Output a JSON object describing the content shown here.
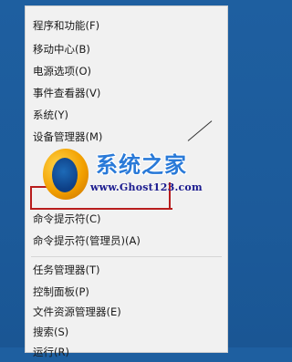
{
  "menu": {
    "items": [
      {
        "name": "programs-and-features",
        "label": "程序和功能(F)"
      },
      {
        "name": "mobility-center",
        "label": "移动中心(B)"
      },
      {
        "name": "power-options",
        "label": "电源选项(O)"
      },
      {
        "name": "event-viewer",
        "label": "事件查看器(V)"
      },
      {
        "name": "system",
        "label": "系统(Y)"
      },
      {
        "name": "device-manager",
        "label": "设备管理器(M)"
      },
      {
        "name": "command-prompt",
        "label": "命令提示符(C)"
      },
      {
        "name": "command-prompt-admin",
        "label": "命令提示符(管理员)(A)"
      },
      {
        "name": "task-manager",
        "label": "任务管理器(T)"
      },
      {
        "name": "control-panel",
        "label": "控制面板(P)"
      },
      {
        "name": "file-explorer",
        "label": "文件资源管理器(E)"
      },
      {
        "name": "search",
        "label": "搜索(S)"
      },
      {
        "name": "run",
        "label": "运行(R)"
      }
    ]
  },
  "watermark": {
    "title": "系统之家",
    "url": "www.Ghost123.com"
  },
  "colors": {
    "desktop": "#1e5fa0",
    "menu_bg": "#f1f1f1",
    "highlight_frame": "#b81d1d"
  }
}
